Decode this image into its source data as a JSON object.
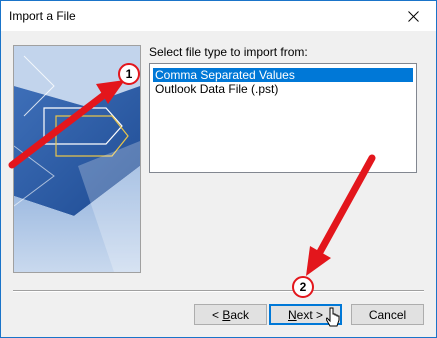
{
  "window": {
    "title": "Import a File",
    "accent": "#1a74c9"
  },
  "main": {
    "prompt": "Select file type to import from:",
    "file_types": [
      {
        "label": "Comma Separated Values",
        "selected": true
      },
      {
        "label": "Outlook Data File (.pst)",
        "selected": false
      }
    ]
  },
  "buttons": {
    "back_prefix": "< ",
    "back_mnemonic": "B",
    "back_rest": "ack",
    "next_mnemonic": "N",
    "next_rest": "ext >",
    "cancel": "Cancel"
  },
  "callouts": [
    {
      "number": "1",
      "color": "#e3161c"
    },
    {
      "number": "2",
      "color": "#e3161c"
    }
  ],
  "icons": {
    "close": "close-icon",
    "cursor": "mouse-pointer-icon"
  }
}
